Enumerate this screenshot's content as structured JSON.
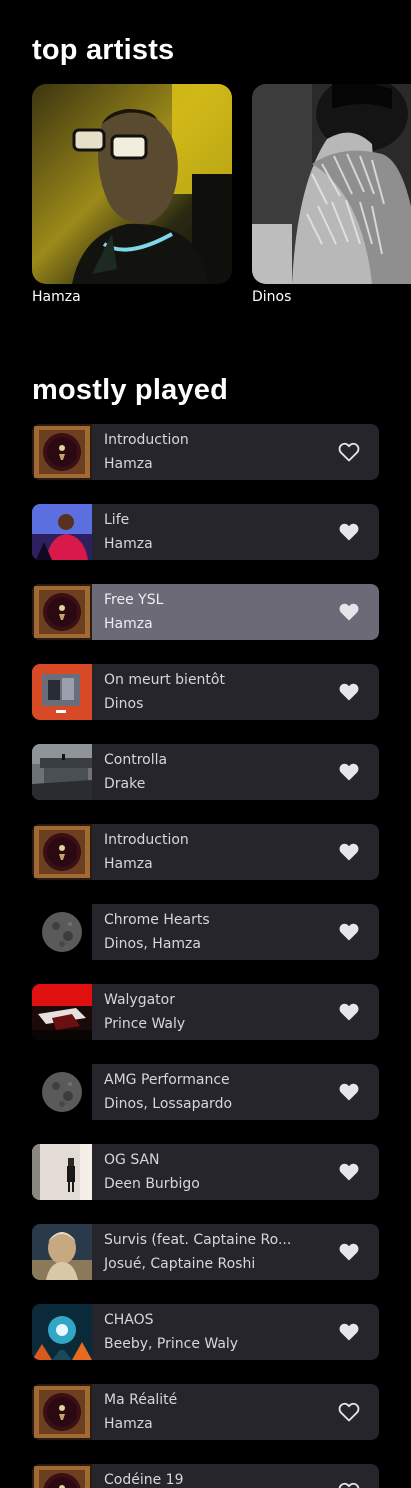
{
  "sections": {
    "top_artists_title": "top artists",
    "mostly_played_title": "mostly played"
  },
  "artists": [
    {
      "name": "Hamza"
    },
    {
      "name": "Dinos"
    }
  ],
  "songs": [
    {
      "title": "Introduction",
      "artist": "Hamza",
      "liked": false,
      "cover": "hamza-album"
    },
    {
      "title": "Life",
      "artist": "Hamza",
      "liked": true,
      "cover": "life"
    },
    {
      "title": "Free YSL",
      "artist": "Hamza",
      "liked": true,
      "cover": "hamza-album",
      "active": true
    },
    {
      "title": "On meurt bientôt",
      "artist": "Dinos",
      "liked": true,
      "cover": "dinos-orange"
    },
    {
      "title": "Controlla",
      "artist": "Drake",
      "liked": true,
      "cover": "views"
    },
    {
      "title": "Introduction",
      "artist": "Hamza",
      "liked": true,
      "cover": "hamza-album"
    },
    {
      "title": "Chrome Hearts",
      "artist": "Dinos, Hamza",
      "liked": true,
      "cover": "moon"
    },
    {
      "title": "Walygator",
      "artist": "Prince Waly",
      "liked": true,
      "cover": "walygator"
    },
    {
      "title": "AMG Performance",
      "artist": "Dinos, Lossapardo",
      "liked": true,
      "cover": "moon"
    },
    {
      "title": "OG SAN",
      "artist": "Deen Burbigo",
      "liked": true,
      "cover": "og-san"
    },
    {
      "title": "Survis (feat. Captaine Ro...",
      "artist": "Josué, Captaine Roshi",
      "liked": true,
      "cover": "survis"
    },
    {
      "title": "CHAOS",
      "artist": "Beeby, Prince Waly",
      "liked": true,
      "cover": "chaos"
    },
    {
      "title": "Ma Réalité",
      "artist": "Hamza",
      "liked": false,
      "cover": "hamza-album"
    },
    {
      "title": "Codéine 19",
      "artist": "",
      "liked": false,
      "cover": "hamza-album"
    }
  ],
  "colors": {
    "background": "#000000",
    "row": "#26252c",
    "row_active": "#6b6a76",
    "text": "#d7d6dc"
  }
}
